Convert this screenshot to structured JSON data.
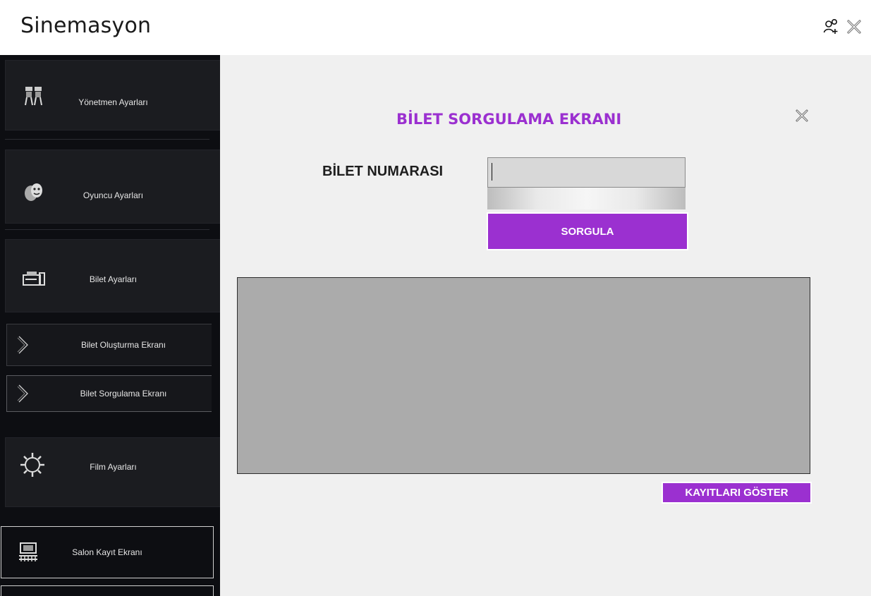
{
  "app": {
    "title": "Sinemasyon"
  },
  "titlebar": {
    "icons": [
      "add-user-icon",
      "close-icon"
    ]
  },
  "sidebar": {
    "items": [
      {
        "label": "Yönetmen  Ayarları",
        "icon": "directors-icon"
      },
      {
        "label": "Oyuncu Ayarları",
        "icon": "theater-masks-icon"
      },
      {
        "label": "Bilet Ayarları",
        "icon": "ticket-printer-icon"
      },
      {
        "label": "Bilet Oluşturma Ekranı",
        "icon": "chevron-right-icon"
      },
      {
        "label": "Bilet Sorgulama Ekranı",
        "icon": "chevron-right-icon"
      },
      {
        "label": "Film Ayarları",
        "icon": "gear-icon"
      },
      {
        "label": "Salon Kayıt Ekranı",
        "icon": "cinema-hall-icon"
      }
    ]
  },
  "main": {
    "title": "BİLET SORGULAMA EKRANI",
    "ticket_label": "BİLET NUMARASI",
    "ticket_value": "",
    "query_button": "SORGULA",
    "show_records_button": "KAYITLARI GÖSTER",
    "colors": {
      "accent": "#9b30d0",
      "grid_bg": "#ababab",
      "sidebar_bg": "#0d0e12",
      "main_bg": "#f0f0f0"
    }
  }
}
